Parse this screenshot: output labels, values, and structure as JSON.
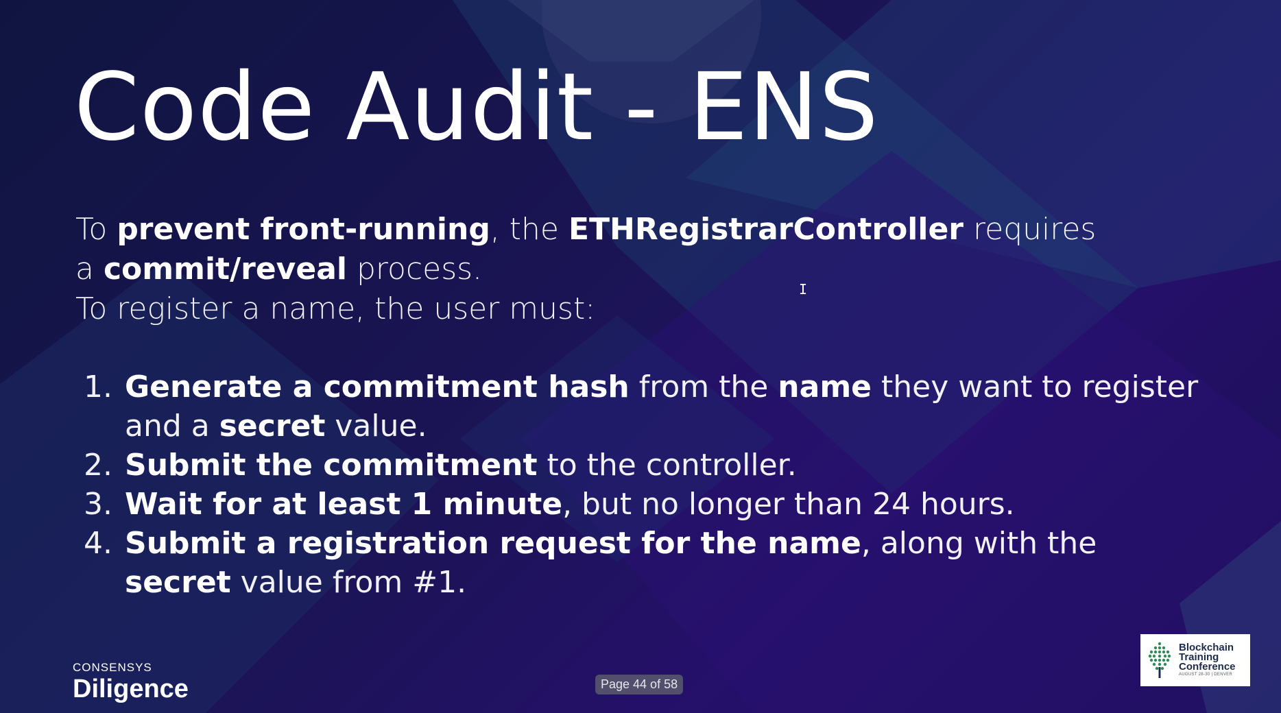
{
  "slide": {
    "title": "Code Audit - ENS",
    "intro": {
      "p1_a": "To ",
      "p1_b": "prevent front-running",
      "p1_c": ", the ",
      "p1_d": "ETHRegistrarController",
      "p1_e": " requires a ",
      "p1_f": "commit/reveal",
      "p1_g": " process.",
      "p2": "To register a name, the user must:"
    },
    "steps": [
      {
        "num": "1.",
        "parts": [
          "Generate a commitment hash",
          " from the ",
          "name",
          " they want to register and a ",
          "secret",
          " value."
        ]
      },
      {
        "num": "2.",
        "parts": [
          "Submit the commitment",
          " to the controller."
        ]
      },
      {
        "num": "3.",
        "parts": [
          "Wait for at least 1 minute",
          ", but no longer than 24 hours."
        ]
      },
      {
        "num": "4.",
        "parts": [
          "Submit a registration request for the name",
          ", along with the ",
          "secret",
          " value from #1."
        ]
      }
    ]
  },
  "footer": {
    "brand_top": "CONSENSYS",
    "brand_main": "Diligence",
    "page_indicator": "Page 44 of 58",
    "conference": {
      "line1": "Blockchain",
      "line2": "Training",
      "line3": "Conference",
      "sub": "AUGUST 28-30 | DENVER"
    }
  },
  "cursor_glyph": "I"
}
